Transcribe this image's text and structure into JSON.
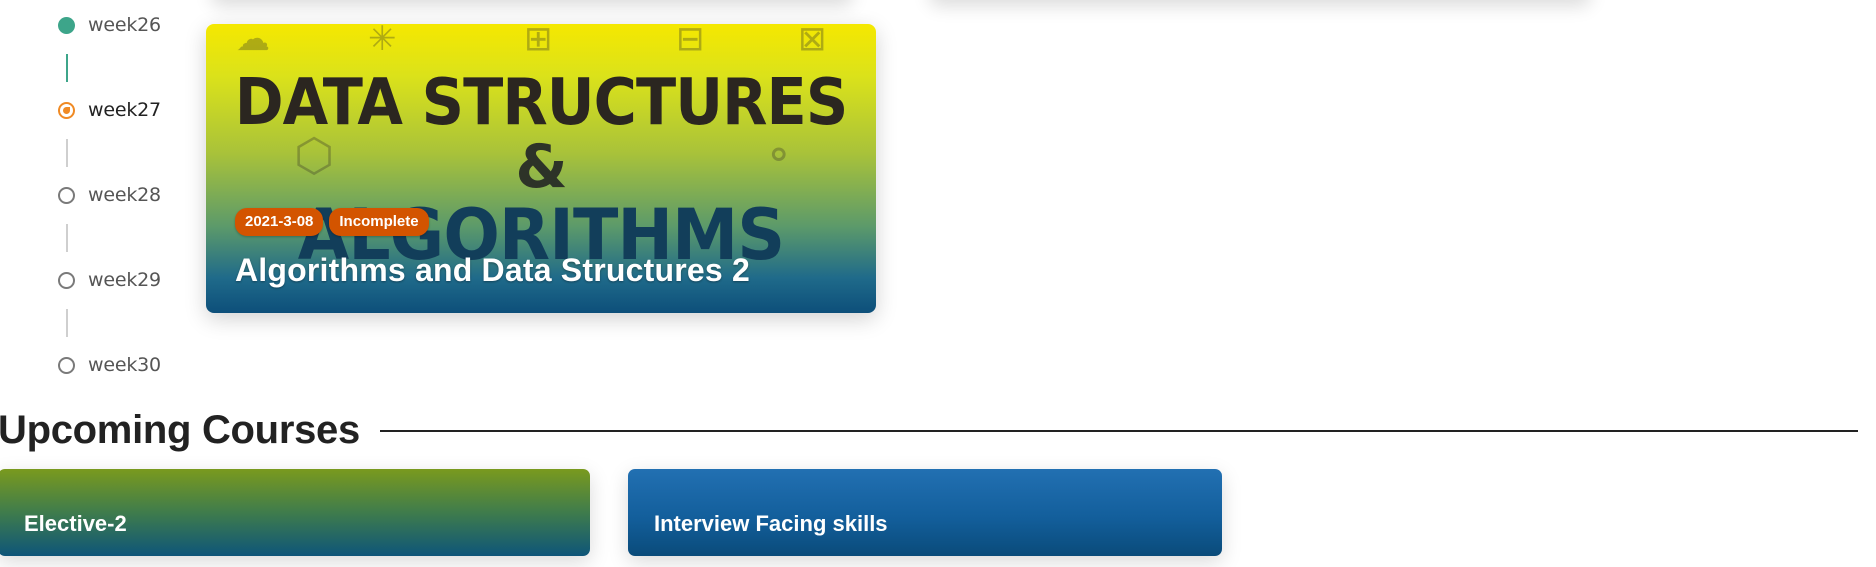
{
  "timeline": {
    "items": [
      {
        "label": "week26",
        "state": "done"
      },
      {
        "label": "week27",
        "state": "current"
      },
      {
        "label": "week28",
        "state": "pending"
      },
      {
        "label": "week29",
        "state": "pending"
      },
      {
        "label": "week30",
        "state": "pending"
      }
    ]
  },
  "course": {
    "cover_line1": "DATA STRUCTURES",
    "cover_line2": "&",
    "cover_line3": "ALGORITHMS",
    "date_badge": "2021-3-08",
    "status_badge": "Incomplete",
    "title": "Algorithms and Data Structures 2",
    "badge_color": "#d35400"
  },
  "upcoming": {
    "heading": "Upcoming Courses",
    "courses": [
      {
        "title": "Elective-2"
      },
      {
        "title": "Interview Facing skills"
      }
    ]
  },
  "colors": {
    "done": "#3da58a",
    "current": "#f08a24",
    "pending": "#7a7a7a"
  }
}
